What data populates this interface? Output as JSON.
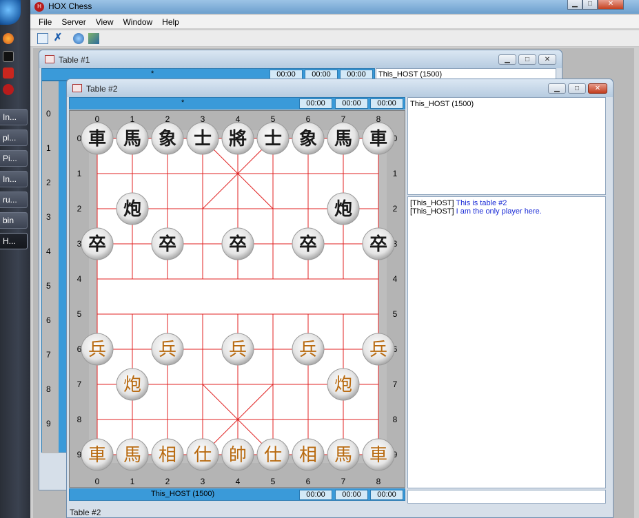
{
  "taskbar": {
    "items": [
      {
        "label": "In..."
      },
      {
        "label": "pl..."
      },
      {
        "label": "Pi..."
      },
      {
        "label": "In..."
      },
      {
        "label": "ru..."
      },
      {
        "label": "bin"
      },
      {
        "label": "H..."
      }
    ]
  },
  "app": {
    "title": "HOX Chess",
    "icon": "hox-app-icon"
  },
  "menu": [
    {
      "label": "File"
    },
    {
      "label": "Server"
    },
    {
      "label": "View"
    },
    {
      "label": "Window"
    },
    {
      "label": "Help"
    }
  ],
  "toolbar": [
    "new-table-icon",
    "close-table-icon",
    "connect-icon",
    "export-icon"
  ],
  "table1": {
    "title": "Table #1",
    "marker": "*",
    "timers": [
      "00:00",
      "00:00",
      "00:00"
    ],
    "player": "This_HOST (1500)",
    "left_rank_labels": [
      "0",
      "1",
      "2",
      "3",
      "4",
      "5",
      "6",
      "7",
      "8",
      "9"
    ]
  },
  "table2": {
    "title": "Table #2",
    "top_bar": {
      "marker": "*",
      "timers": [
        "00:00",
        "00:00",
        "00:00"
      ]
    },
    "bottom_bar": {
      "player": "This_HOST (1500)",
      "timers": [
        "00:00",
        "00:00",
        "00:00"
      ]
    },
    "file_labels": [
      "0",
      "1",
      "2",
      "3",
      "4",
      "5",
      "6",
      "7",
      "8"
    ],
    "rank_labels": [
      "0",
      "1",
      "2",
      "3",
      "4",
      "5",
      "6",
      "7",
      "8",
      "9"
    ],
    "players_panel": [
      "This_HOST (1500)"
    ],
    "chat": [
      {
        "sender": "[This_HOST]",
        "text": "This is table #2"
      },
      {
        "sender": "[This_HOST]",
        "text": "I am the only player here."
      }
    ],
    "chat_input": "",
    "status": "Table #2"
  },
  "board": {
    "colors": {
      "line": "#e02020",
      "black_piece": "#1a1a1a",
      "red_piece": "#b86a10"
    },
    "pieces": [
      {
        "char": "車",
        "side": "black",
        "file": 0,
        "rank": 0
      },
      {
        "char": "馬",
        "side": "black",
        "file": 1,
        "rank": 0
      },
      {
        "char": "象",
        "side": "black",
        "file": 2,
        "rank": 0
      },
      {
        "char": "士",
        "side": "black",
        "file": 3,
        "rank": 0
      },
      {
        "char": "將",
        "side": "black",
        "file": 4,
        "rank": 0
      },
      {
        "char": "士",
        "side": "black",
        "file": 5,
        "rank": 0
      },
      {
        "char": "象",
        "side": "black",
        "file": 6,
        "rank": 0
      },
      {
        "char": "馬",
        "side": "black",
        "file": 7,
        "rank": 0
      },
      {
        "char": "車",
        "side": "black",
        "file": 8,
        "rank": 0
      },
      {
        "char": "炮",
        "side": "black",
        "file": 1,
        "rank": 2
      },
      {
        "char": "炮",
        "side": "black",
        "file": 7,
        "rank": 2
      },
      {
        "char": "卒",
        "side": "black",
        "file": 0,
        "rank": 3
      },
      {
        "char": "卒",
        "side": "black",
        "file": 2,
        "rank": 3
      },
      {
        "char": "卒",
        "side": "black",
        "file": 4,
        "rank": 3
      },
      {
        "char": "卒",
        "side": "black",
        "file": 6,
        "rank": 3
      },
      {
        "char": "卒",
        "side": "black",
        "file": 8,
        "rank": 3
      },
      {
        "char": "兵",
        "side": "red",
        "file": 0,
        "rank": 6
      },
      {
        "char": "兵",
        "side": "red",
        "file": 2,
        "rank": 6
      },
      {
        "char": "兵",
        "side": "red",
        "file": 4,
        "rank": 6
      },
      {
        "char": "兵",
        "side": "red",
        "file": 6,
        "rank": 6
      },
      {
        "char": "兵",
        "side": "red",
        "file": 8,
        "rank": 6
      },
      {
        "char": "炮",
        "side": "red",
        "file": 1,
        "rank": 7
      },
      {
        "char": "炮",
        "side": "red",
        "file": 7,
        "rank": 7
      },
      {
        "char": "車",
        "side": "red",
        "file": 0,
        "rank": 9
      },
      {
        "char": "馬",
        "side": "red",
        "file": 1,
        "rank": 9
      },
      {
        "char": "相",
        "side": "red",
        "file": 2,
        "rank": 9
      },
      {
        "char": "仕",
        "side": "red",
        "file": 3,
        "rank": 9
      },
      {
        "char": "帥",
        "side": "red",
        "file": 4,
        "rank": 9
      },
      {
        "char": "仕",
        "side": "red",
        "file": 5,
        "rank": 9
      },
      {
        "char": "相",
        "side": "red",
        "file": 6,
        "rank": 9
      },
      {
        "char": "馬",
        "side": "red",
        "file": 7,
        "rank": 9
      },
      {
        "char": "車",
        "side": "red",
        "file": 8,
        "rank": 9
      }
    ]
  }
}
